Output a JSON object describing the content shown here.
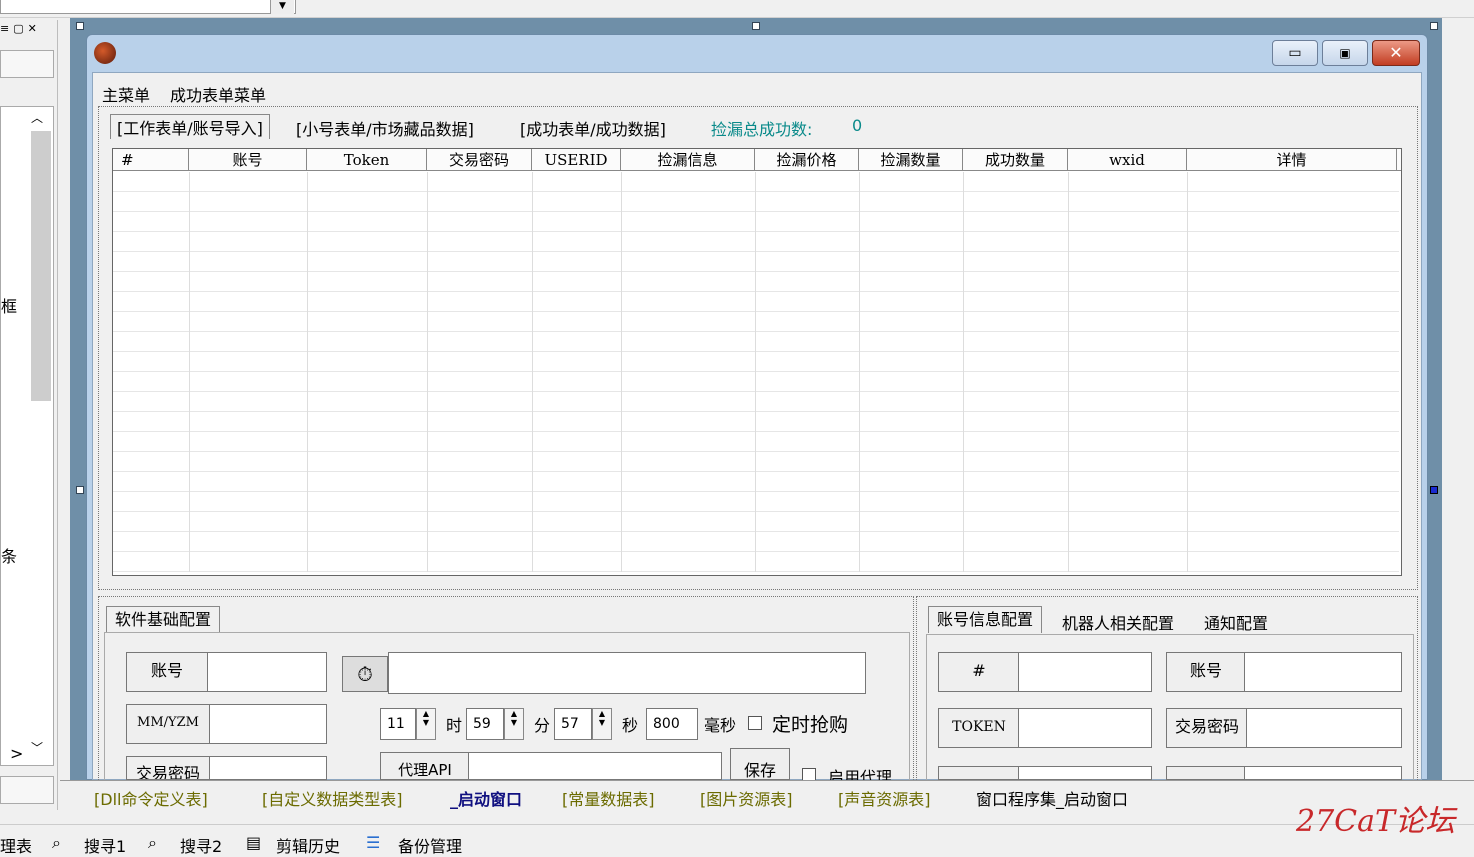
{
  "designer_tabs": [
    "[Dll命令定义表]",
    "[自定义数据类型表]",
    "_启动窗口",
    "[常量数据表]",
    "[图片资源表]",
    "[声音资源表]",
    "窗口程序集_启动窗口"
  ],
  "status_tools": [
    "理表",
    "搜寻1",
    "搜寻2",
    "剪辑历史",
    "备份管理"
  ],
  "left_panel": {
    "label_1": "框",
    "label_2": "条",
    "arrow_right": ">"
  },
  "menu": [
    "主菜单",
    "成功表单菜单"
  ],
  "top_tabs": [
    "[工作表单/账号导入]",
    "[小号表单/市场藏品数据]",
    "[成功表单/成功数据]"
  ],
  "success_count": {
    "label": "捡漏总成功数:",
    "value": "0"
  },
  "grid_columns": [
    "#",
    "账号",
    "Token",
    "交易密码",
    "USERID",
    "捡漏信息",
    "捡漏价格",
    "捡漏数量",
    "成功数量",
    "wxid",
    "详情"
  ],
  "left_config": {
    "tab": "软件基础配置",
    "account_label": "账号",
    "mm_label": "MM/YZM",
    "trade_pwd_label": "交易密码",
    "hour": "11",
    "hour_unit": "时",
    "minute": "59",
    "minute_unit": "分",
    "second": "57",
    "second_unit": "秒",
    "ms": "800",
    "ms_unit": "毫秒",
    "timed_buy": "定时抢购",
    "proxy_api": "代理API",
    "save": "保存",
    "enable_proxy": "启用代理"
  },
  "right_config": {
    "tabs": [
      "账号信息配置",
      "机器人相关配置",
      "通知配置"
    ],
    "hash_label": "#",
    "account_label": "账号",
    "token_label": "TOKEN",
    "trade_pwd_label": "交易密码"
  },
  "watermark": "27CaT论坛"
}
